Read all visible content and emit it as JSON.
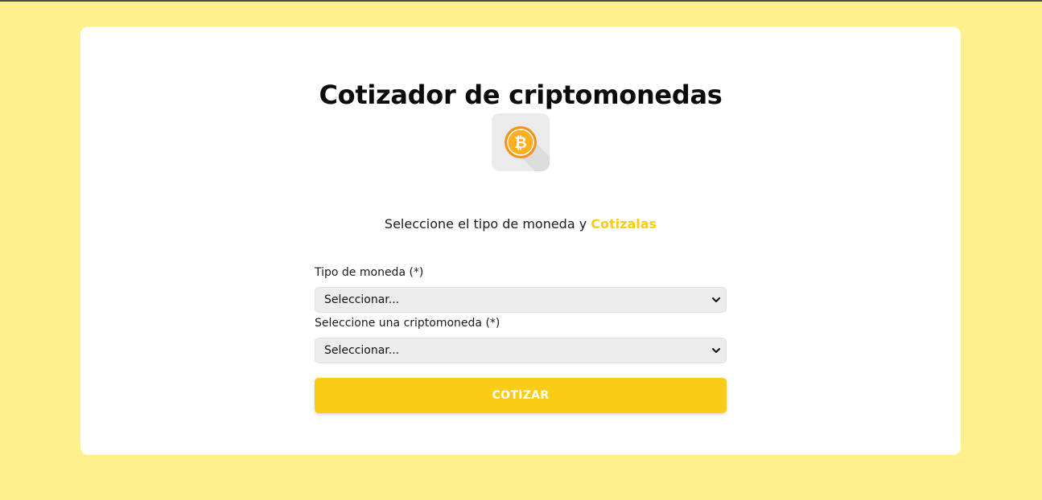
{
  "page": {
    "title": "Cotizador de criptomonedas",
    "subtitle_text": "Seleccione el tipo de moneda y",
    "subtitle_accent": "Cotizalas"
  },
  "logo": {
    "icon": "bitcoin-icon",
    "glyph": "₿"
  },
  "form": {
    "currency_label": "Tipo de moneda (*)",
    "currency_value": "Seleccionar...",
    "crypto_label": "Seleccione una criptomoneda (*)",
    "crypto_value": "Seleccionar...",
    "submit_label": "COTIZAR"
  },
  "colors": {
    "background": "#fef08a",
    "accent": "#facc15",
    "card": "#ffffff",
    "bitcoin": "#f7931a"
  }
}
